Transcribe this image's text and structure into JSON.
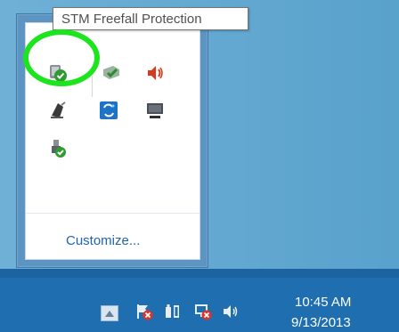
{
  "tooltip": {
    "text": "STM Freefall Protection"
  },
  "flyout": {
    "icons": [
      {
        "name": "stm-freefall-protection-icon"
      },
      {
        "name": "security-check-icon"
      },
      {
        "name": "speaker-volume-icon"
      },
      {
        "name": "usb-device-icon"
      },
      {
        "name": "sync-app-icon"
      },
      {
        "name": "display-monitor-icon"
      },
      {
        "name": "safely-remove-hardware-icon"
      }
    ],
    "customize_label": "Customize..."
  },
  "taskbar": {
    "show_hidden_icon": "up-arrow-icon",
    "tray_icons": [
      {
        "name": "action-center-flag-icon"
      },
      {
        "name": "power-battery-icon"
      },
      {
        "name": "network-error-icon"
      },
      {
        "name": "volume-icon"
      }
    ],
    "clock": {
      "time": "10:45 AM",
      "date": "9/13/2013"
    }
  },
  "colors": {
    "desktop": "#5aa2cb",
    "taskbar": "#1f6fb0",
    "highlight_ring": "#1de51d",
    "link": "#1d64b3"
  }
}
